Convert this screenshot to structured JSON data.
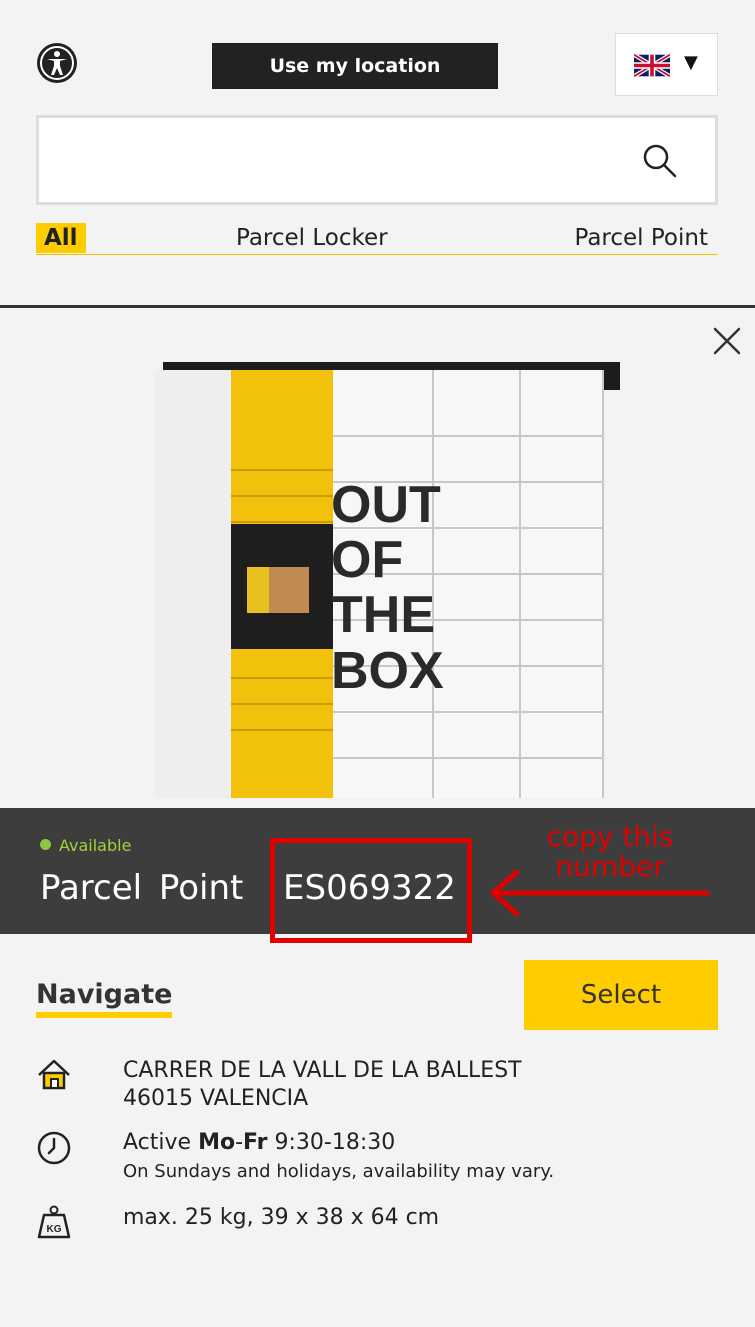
{
  "header": {
    "use_location_label": "Use my location",
    "language_caret": "▼"
  },
  "search": {
    "placeholder": "",
    "value": ""
  },
  "filters": {
    "all": "All",
    "parcel_locker": "Parcel Locker",
    "parcel_point": "Parcel Point"
  },
  "locker_image_text": [
    "OUT",
    "OF",
    "THE",
    "BOX"
  ],
  "detail": {
    "status": "Available",
    "type_label": "Parcel Point",
    "id": "ES069322",
    "annotation": "copy this number",
    "navigate_label": "Navigate",
    "select_label": "Select",
    "address_line1": "CARRER DE LA VALL DE LA BALLEST",
    "address_line2": "46015 VALENCIA",
    "hours_prefix": "Active",
    "hours_days_a": "Mo",
    "hours_dash": "-",
    "hours_days_b": "Fr",
    "hours_time": "9:30-18:30",
    "hours_note": "On Sundays and holidays, availability may vary.",
    "limits": "max. 25 kg, 39 x 38 x 64 cm"
  },
  "colors": {
    "accent": "#ffcc00",
    "dark_band": "#3d3d3d",
    "available": "#8dc63f",
    "annotation_red": "#e00000"
  },
  "icons": [
    "accessibility-icon",
    "uk-flag-icon",
    "search-icon",
    "close-icon",
    "home-icon",
    "clock-icon",
    "weight-icon"
  ]
}
